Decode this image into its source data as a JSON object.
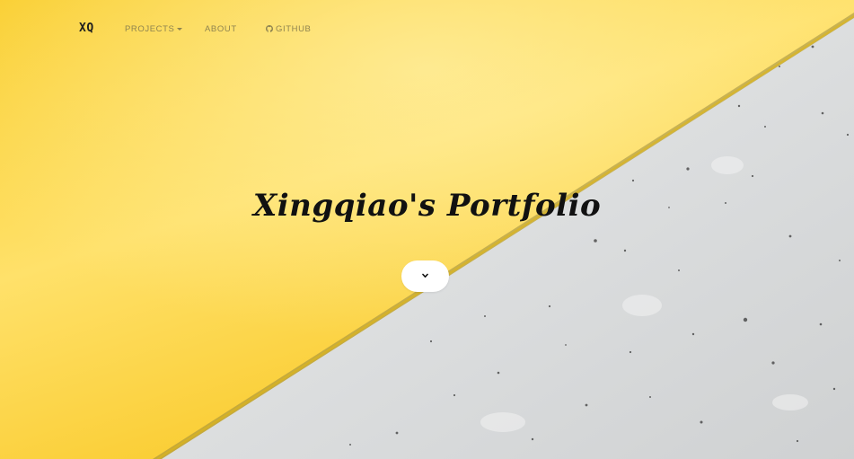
{
  "navbar": {
    "brand": "XQ",
    "projects_label": "PROJECTS",
    "about_label": "ABOUT",
    "github_label": "GITHUB"
  },
  "hero": {
    "title": "Xingqiao's Portfolio",
    "scroll_button_icon": "chevron-down-icon"
  },
  "colors": {
    "yellow_light": "#ffe071",
    "yellow_main": "#fdd835",
    "yellow_dark": "#f7c51b",
    "concrete_light": "#dadcdd",
    "concrete_dark": "#c9cbcc",
    "nav_text": "#8f8450",
    "title_text": "#111111"
  }
}
